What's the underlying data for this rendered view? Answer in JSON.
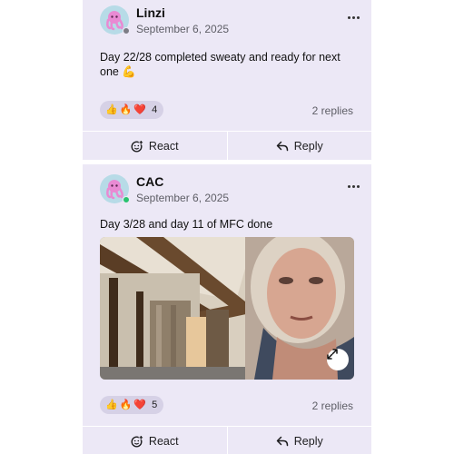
{
  "posts": [
    {
      "author": "Linzi",
      "date": "September 6, 2025",
      "text": "Day 22/28 completed sweaty and ready for next one 💪",
      "online": false,
      "reactions": {
        "emojis": [
          "👍",
          "🔥",
          "❤️"
        ],
        "count": "4"
      },
      "replies": "2 replies",
      "actions": {
        "react": "React",
        "reply": "Reply"
      }
    },
    {
      "author": "CAC",
      "date": "September 6, 2025",
      "text": "Day 3/28 and day 11 of MFC done",
      "online": true,
      "has_photo": true,
      "reactions": {
        "emojis": [
          "👍",
          "🔥",
          "❤️"
        ],
        "count": "5"
      },
      "replies": "2 replies",
      "actions": {
        "react": "React",
        "reply": "Reply"
      }
    }
  ],
  "colors": {
    "card_background": "#ece8f6",
    "reaction_pill": "#d6d1e6",
    "online_dot": "#28c36e",
    "avatar_background": "#b7dbe7"
  },
  "icons": {
    "more": "more-horizontal-icon",
    "react": "add-reaction-icon",
    "reply": "reply-arrow-icon",
    "expand": "expand-icon"
  }
}
